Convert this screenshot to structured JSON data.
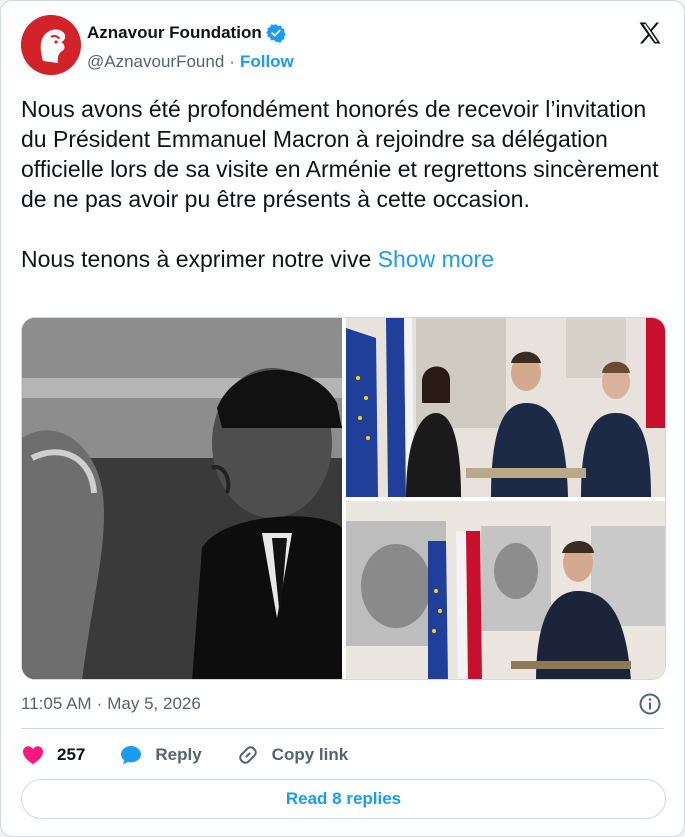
{
  "author": {
    "display_name": "Aznavour Foundation",
    "handle": "@AznavourFound",
    "separator": "·",
    "follow_label": "Follow",
    "verified": true
  },
  "tweet": {
    "paragraph1": "Nous avons été profondément honorés de recevoir l’invitation du Président Emmanuel Macron à rejoindre sa délégation officielle lors de sa visite en Arménie et regrettons sincèrement de ne pas avoir pu être présents à cette occasion.",
    "paragraph2": "Nous tenons à exprimer notre vive",
    "show_more_label": "Show more"
  },
  "media": {
    "photos": [
      {
        "description_icon": "photo-bw-portrait"
      },
      {
        "description_icon": "photo-signing-guestbook-group"
      },
      {
        "description_icon": "photo-signing-guestbook-portraits"
      }
    ]
  },
  "meta": {
    "time": "11:05 AM",
    "separator": "·",
    "date": "May 5, 2026"
  },
  "actions": {
    "likes_count": "257",
    "reply_label": "Reply",
    "copy_link_label": "Copy link"
  },
  "replies": {
    "read_label": "Read 8 replies"
  },
  "colors": {
    "accent": "#1d9bf0",
    "heart": "#f91880",
    "text": "#0f1419",
    "muted": "#536471",
    "border": "#cfd9de",
    "brand_red": "#d2232a"
  }
}
